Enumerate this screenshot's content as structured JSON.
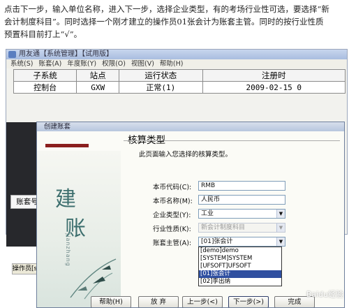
{
  "intro": {
    "line1": "点击下一步，输入单位名称，进入下一步，选择企业类型，有的考场行业性可选，要选择“新",
    "line2": "会计制度科目”。同时选择一个刚才建立的操作员01张会计为账套主管。同时的按行业性质",
    "line3": "预置科目前打上“√”。"
  },
  "back_window": {
    "title": "用友通【系统管理】【试用版】",
    "menu": [
      "系统(S)",
      "账套(A)",
      "年度账(Y)",
      "权限(O)",
      "视图(V)",
      "帮助(H)"
    ],
    "table": {
      "columns": [
        "子系统",
        "站点",
        "运行状态",
        "注册时"
      ],
      "rows": [
        [
          "控制台",
          "GXW",
          "正常(1)",
          "2009-02-15 0"
        ]
      ]
    },
    "account_label": "账套号",
    "operator_label": "操作员[s"
  },
  "dialog": {
    "title": "创建账套",
    "heading": "核算类型",
    "description": "此页面输入您选择的核算类型。",
    "left_chars": [
      "建",
      "账"
    ],
    "left_pinyin": "jianzhang",
    "fields": {
      "currency_code": {
        "label": "本币代码(C):",
        "value": "RMB"
      },
      "currency_name": {
        "label": "本币名称(M):",
        "value": "人民币"
      },
      "enterprise_type": {
        "label": "企业类型(Y):",
        "value": "工业"
      },
      "industry": {
        "label": "行业性质(K):",
        "value": "新会计制度科目"
      },
      "supervisor": {
        "label": "账套主管(A):",
        "value": "[01]张会计"
      }
    },
    "dropdown_options": [
      "[demo]demo",
      "[SYSTEM]SYSTEM",
      "[UFSOFT]UFSOFT",
      "[01]张会计",
      "[02]李出纳"
    ],
    "selected_option_index": 3,
    "buttons": {
      "help": "帮助(H)",
      "cancel": "放 弃",
      "prev": "上一步(<)",
      "next": "下一步(>)",
      "finish": "完成"
    }
  },
  "watermark": "Baidu经验"
}
